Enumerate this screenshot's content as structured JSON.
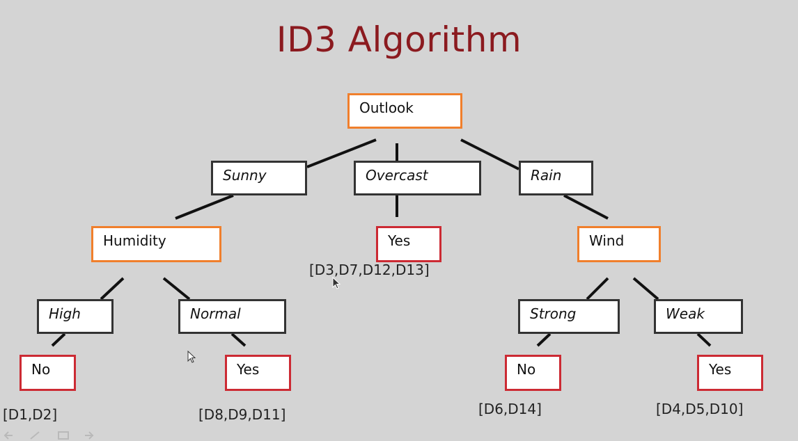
{
  "title": "ID3 Algorithm",
  "nodes": {
    "outlook": "Outlook",
    "sunny": "Sunny",
    "overcast": "Overcast",
    "rain": "Rain",
    "humidity": "Humidity",
    "overcast_yes": "Yes",
    "wind": "Wind",
    "high": "High",
    "normal": "Normal",
    "strong": "Strong",
    "weak": "Weak",
    "high_no": "No",
    "normal_yes": "Yes",
    "strong_no": "No",
    "weak_yes": "Yes"
  },
  "datasets": {
    "overcast": "[D3,D7,D12,D13]",
    "high": "[D1,D2]",
    "normal": "[D8,D9,D11]",
    "strong": "[D6,D14]",
    "weak": "[D4,D5,D10]"
  },
  "colors": {
    "title": "#8b1a1f",
    "attribute_border": "#f07f2c",
    "branch_border": "#333333",
    "leaf_border": "#cc2a33",
    "background": "#d4d4d4"
  },
  "icons": [
    "mouse-pointer-icon"
  ]
}
